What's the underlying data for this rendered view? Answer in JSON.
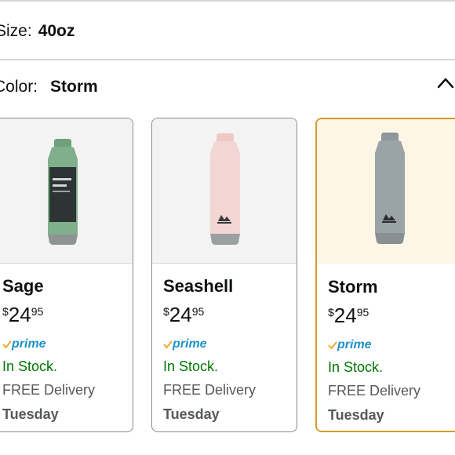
{
  "size": {
    "label": "Size:",
    "value": "40oz"
  },
  "color": {
    "label": "Color:",
    "value": "Storm"
  },
  "icons": {
    "collapse": "chevron-up-icon",
    "prime_check": "check-icon"
  },
  "colors": {
    "accent": "#d59b2b",
    "in_stock": "#007600",
    "prime": "#1f92c9"
  },
  "options": [
    {
      "name": "Sage",
      "currency": "$",
      "price_whole": "24",
      "price_fraction": "95",
      "prime": "prime",
      "stock": "In Stock.",
      "delivery": "FREE Delivery",
      "day": "Tuesday",
      "bottle_color": "#7fb08b",
      "selected": false
    },
    {
      "name": "Seashell",
      "currency": "$",
      "price_whole": "24",
      "price_fraction": "95",
      "prime": "prime",
      "stock": "In Stock.",
      "delivery": "FREE Delivery",
      "day": "Tuesday",
      "bottle_color": "#f2d6d3",
      "selected": false
    },
    {
      "name": "Storm",
      "currency": "$",
      "price_whole": "24",
      "price_fraction": "95",
      "prime": "prime",
      "stock": "In Stock.",
      "delivery": "FREE Delivery",
      "day": "Tuesday",
      "bottle_color": "#9aa3a5",
      "selected": true
    }
  ]
}
